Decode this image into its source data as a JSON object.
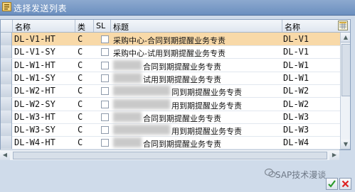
{
  "window": {
    "title": "选择发送列表"
  },
  "table": {
    "headers": {
      "name": "名称",
      "type": "类",
      "sl": "SL",
      "title": "标题",
      "name2": "名称"
    },
    "rows": [
      {
        "name": "DL-V1-HT",
        "type": "C",
        "title": "采购中心-合同到期提醒业务专责",
        "name2": "DL-V1",
        "selected": true
      },
      {
        "name": "DL-V1-SY",
        "type": "C",
        "title": "采购中心-试用到期提醒业务专责",
        "name2": "DL-V1",
        "selected": false
      },
      {
        "name": "DL-W1-HT",
        "type": "C",
        "title": "合同到期提醒业务专责",
        "name2": "DL-W1",
        "selected": false
      },
      {
        "name": "DL-W1-SY",
        "type": "C",
        "title": "试用到期提醒业务专责",
        "name2": "DL-W1",
        "selected": false
      },
      {
        "name": "DL-W2-HT",
        "type": "C",
        "title": "同到期提醒业务专责",
        "name2": "DL-W2",
        "selected": false
      },
      {
        "name": "DL-W2-SY",
        "type": "C",
        "title": "用到期提醒业务专责",
        "name2": "DL-W2",
        "selected": false
      },
      {
        "name": "DL-W3-HT",
        "type": "C",
        "title": "合同到期提醒业务专责",
        "name2": "DL-W3",
        "selected": false
      },
      {
        "name": "DL-W3-SY",
        "type": "C",
        "title": "用到期提醒业务专责",
        "name2": "DL-W3",
        "selected": false
      },
      {
        "name": "DL-W4-HT",
        "type": "C",
        "title": "合同到期提醒业务专责",
        "name2": "DL-W4",
        "selected": false
      }
    ]
  },
  "watermark": {
    "text": "SAP技术漫谈"
  },
  "icons": {
    "title": "window-icon",
    "layout": "table-settings-icon",
    "ok": "checkmark-icon",
    "cancel": "cancel-icon"
  },
  "colors": {
    "title_bar": "#6b8fbf",
    "selected_row": "#f8d9a8",
    "background": "#cfdbea"
  }
}
